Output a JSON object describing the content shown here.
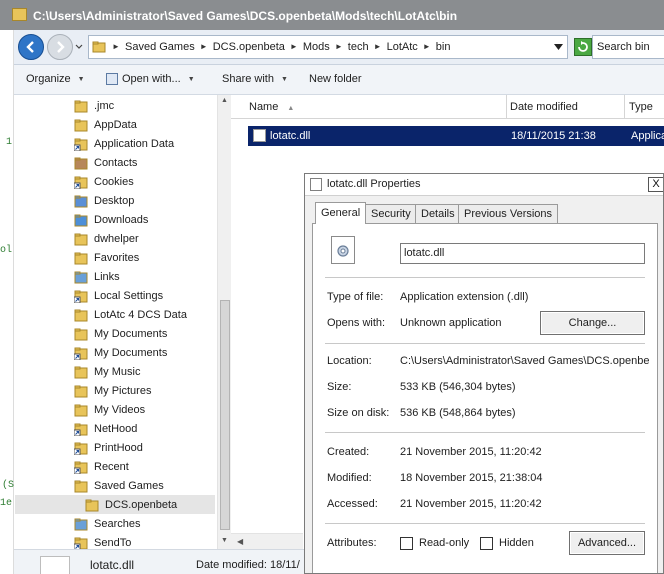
{
  "window": {
    "title": "C:\\Users\\Administrator\\Saved Games\\DCS.openbeta\\Mods\\tech\\LotAtc\\bin"
  },
  "address": {
    "crumbs": [
      "Saved Games",
      "DCS.openbeta",
      "Mods",
      "tech",
      "LotAtc",
      "bin"
    ],
    "search_placeholder": "Search bin"
  },
  "toolbar": {
    "organize": "Organize",
    "open_with": "Open with...",
    "share_with": "Share with",
    "new_folder": "New folder"
  },
  "nav": {
    "items": [
      {
        "label": ".jmc",
        "icon": "folder"
      },
      {
        "label": "AppData",
        "icon": "folder"
      },
      {
        "label": "Application Data",
        "icon": "shortcut"
      },
      {
        "label": "Contacts",
        "icon": "contacts"
      },
      {
        "label": "Cookies",
        "icon": "shortcut"
      },
      {
        "label": "Desktop",
        "icon": "desktop"
      },
      {
        "label": "Downloads",
        "icon": "downloads"
      },
      {
        "label": "dwhelper",
        "icon": "folder"
      },
      {
        "label": "Favorites",
        "icon": "favorites"
      },
      {
        "label": "Links",
        "icon": "links"
      },
      {
        "label": "Local Settings",
        "icon": "shortcut"
      },
      {
        "label": "LotAtc 4 DCS Data",
        "icon": "folder"
      },
      {
        "label": "My Documents",
        "icon": "documents"
      },
      {
        "label": "My Documents",
        "icon": "shortcut"
      },
      {
        "label": "My Music",
        "icon": "music"
      },
      {
        "label": "My Pictures",
        "icon": "pictures"
      },
      {
        "label": "My Videos",
        "icon": "videos"
      },
      {
        "label": "NetHood",
        "icon": "shortcut"
      },
      {
        "label": "PrintHood",
        "icon": "shortcut"
      },
      {
        "label": "Recent",
        "icon": "shortcut"
      },
      {
        "label": "Saved Games",
        "icon": "saved-games"
      },
      {
        "label": "DCS.openbeta",
        "icon": "folder",
        "selected": true
      },
      {
        "label": "Searches",
        "icon": "searches"
      },
      {
        "label": "SendTo",
        "icon": "shortcut"
      }
    ]
  },
  "filelist": {
    "columns": {
      "name": "Name",
      "date": "Date modified",
      "type": "Type"
    },
    "rows": [
      {
        "name": "lotatc.dll",
        "date": "18/11/2015 21:38",
        "type": "Applica"
      }
    ]
  },
  "details": {
    "name": "lotatc.dll",
    "modified": "Date modified: 18/11/"
  },
  "dialog": {
    "title": "lotatc.dll Properties",
    "close": "X",
    "tabs": [
      "General",
      "Security",
      "Details",
      "Previous Versions"
    ],
    "filename": "lotatc.dll",
    "type_label": "Type of file:",
    "type_value": "Application extension (.dll)",
    "opens_label": "Opens with:",
    "opens_value": "Unknown application",
    "change_button": "Change...",
    "location_label": "Location:",
    "location_value": "C:\\Users\\Administrator\\Saved Games\\DCS.openbe",
    "size_label": "Size:",
    "size_value": "533 KB (546,304 bytes)",
    "sizeondisk_label": "Size on disk:",
    "sizeondisk_value": "536 KB (548,864 bytes)",
    "created_label": "Created:",
    "created_value": "21 November 2015, 11:20:42",
    "modified_label": "Modified:",
    "modified_value": "18 November 2015, 21:38:04",
    "accessed_label": "Accessed:",
    "accessed_value": "21 November 2015, 11:20:42",
    "attributes_label": "Attributes:",
    "readonly_label": "Read-only",
    "hidden_label": "Hidden",
    "advanced_button": "Advanced..."
  },
  "background_marks": [
    "1",
    "ol",
    "(S",
    "1e"
  ],
  "colors": {
    "selection": "#0a246a",
    "titlebar": "#8a8d90",
    "folder": "#e8c45a",
    "nav_selected": "#e5e5e5"
  }
}
